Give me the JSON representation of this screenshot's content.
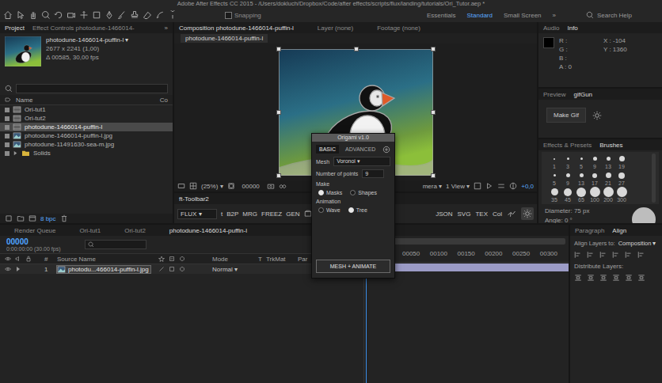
{
  "window": {
    "title": "Adobe After Effects CC 2015 - /Users/dokluch/Dropbox/Code/after effects/scripts/flux/landing/tutorials/Ori_Tutor.aep *"
  },
  "toolbar": {
    "snapping": {
      "label": "Snapping",
      "checked": false
    },
    "workspaces": [
      {
        "label": "Essentials",
        "selected": false
      },
      {
        "label": "Standard",
        "selected": true
      },
      {
        "label": "Small Screen",
        "selected": false
      }
    ],
    "more": "»",
    "search": {
      "placeholder": "Search Help"
    }
  },
  "project": {
    "tabs": [
      {
        "label": "Project",
        "selected": true
      },
      {
        "label": "Effect Controls photodune-1466014-",
        "selected": false
      }
    ],
    "more": "»",
    "preview": {
      "name": "photodune-1466014-puffin-l ▾",
      "size": "2677 x 2241 (1,00)",
      "duration": "Δ 00585, 30,00 fps"
    },
    "columns": [
      "Name",
      "Co"
    ],
    "items": [
      {
        "name": "Ori-tut1",
        "kind": "comp",
        "selected": false
      },
      {
        "name": "Ori-tut2",
        "kind": "comp",
        "selected": false
      },
      {
        "name": "photodune-1466014-puffin-l",
        "kind": "comp",
        "selected": true
      },
      {
        "name": "photodune-1466014-puffin-l.jpg",
        "kind": "footage",
        "selected": false
      },
      {
        "name": "photodune-11491630-sea-m.jpg",
        "kind": "footage",
        "selected": false
      },
      {
        "name": "Solids",
        "kind": "folder",
        "selected": false
      }
    ],
    "bpc": "8 bpc"
  },
  "composition": {
    "tabs": [
      {
        "label": "Composition photodune-1466014-puffin-l",
        "selected": true
      },
      {
        "label": "Layer (none)",
        "selected": false
      },
      {
        "label": "Footage (none)",
        "selected": false
      }
    ],
    "breadcrumb": "photodune-1466014-puffin-l",
    "controls": {
      "zoom": "(25%) ▾",
      "time": "00000",
      "camera": "mera ▾",
      "views": "1 View ▾",
      "exposure": "+0,0"
    }
  },
  "toolbar2": {
    "tab": "ft-Toolbar2",
    "menu": "FLUX ▾",
    "left_buttons": [
      "t",
      "B2P",
      "MRG",
      "FREEZ",
      "GEN"
    ],
    "right_buttons": [
      "JSON",
      "SVG",
      "TEX",
      "Col"
    ]
  },
  "info": {
    "tabs": [
      {
        "label": "Audio",
        "selected": false
      },
      {
        "label": "Info",
        "selected": true
      }
    ],
    "channels": [
      "R :",
      "G :",
      "B :",
      "A : 0"
    ],
    "coords": [
      "X : -104",
      "Y : 1360"
    ]
  },
  "gifgun": {
    "tabs": [
      {
        "label": "Preview",
        "selected": false
      },
      {
        "label": "gifGun",
        "selected": true
      }
    ],
    "button": "Make Gif"
  },
  "brushes": {
    "tabs": [
      {
        "label": "Effects & Presets",
        "selected": false
      },
      {
        "label": "Brushes",
        "selected": true
      }
    ],
    "sizes": [
      "1",
      "3",
      "5",
      "9",
      "13",
      "19",
      "5",
      "9",
      "13",
      "17",
      "21",
      "27",
      "35",
      "45",
      "65",
      "100",
      "200",
      "300"
    ],
    "diameter": "Diameter: 75 px",
    "angle": "Angle: 0 °"
  },
  "timeline": {
    "tabs": [
      {
        "label": "Render Queue",
        "selected": false
      },
      {
        "label": "Ori-tut1",
        "selected": false
      },
      {
        "label": "Ori-tut2",
        "selected": false
      },
      {
        "label": "photodune-1466014-puffin-l",
        "selected": true
      }
    ],
    "time": "00000",
    "fps": "0:00:00:00 (30.00 fps)",
    "columns": {
      "number": "#",
      "source": "Source Name",
      "mode": "Mode",
      "t": "T",
      "trkmat": "TrkMat",
      "parent": "Par"
    },
    "layers": [
      {
        "index": "1",
        "name": "photodu...466014-puffin-l.jpg",
        "mode": "Normal ▾",
        "selected": true
      }
    ],
    "ruler": [
      "00050",
      "00100",
      "00150",
      "00200",
      "00250",
      "00300"
    ]
  },
  "align": {
    "tabs": [
      {
        "label": "Paragraph",
        "selected": false
      },
      {
        "label": "Align",
        "selected": true
      }
    ],
    "align_to_label": "Align Layers to:",
    "align_to": "Composition ▾",
    "distribute": "Distribute Layers:"
  },
  "origami": {
    "title": "Origami v1.0",
    "tabs": [
      {
        "label": "BASIC",
        "selected": true
      },
      {
        "label": "ADVANCED",
        "selected": false
      }
    ],
    "mesh": {
      "label": "Mesh",
      "value": "Voronoi ▾"
    },
    "points": {
      "label": "Number of points",
      "value": "9"
    },
    "make": {
      "label": "Make",
      "options": [
        {
          "label": "Masks",
          "selected": true
        },
        {
          "label": "Shapes",
          "selected": false
        }
      ]
    },
    "animation": {
      "label": "Animation",
      "options": [
        {
          "label": "Wave",
          "selected": false
        },
        {
          "label": "Tree",
          "selected": true
        }
      ]
    },
    "button": "MESH + ANIMATE"
  }
}
